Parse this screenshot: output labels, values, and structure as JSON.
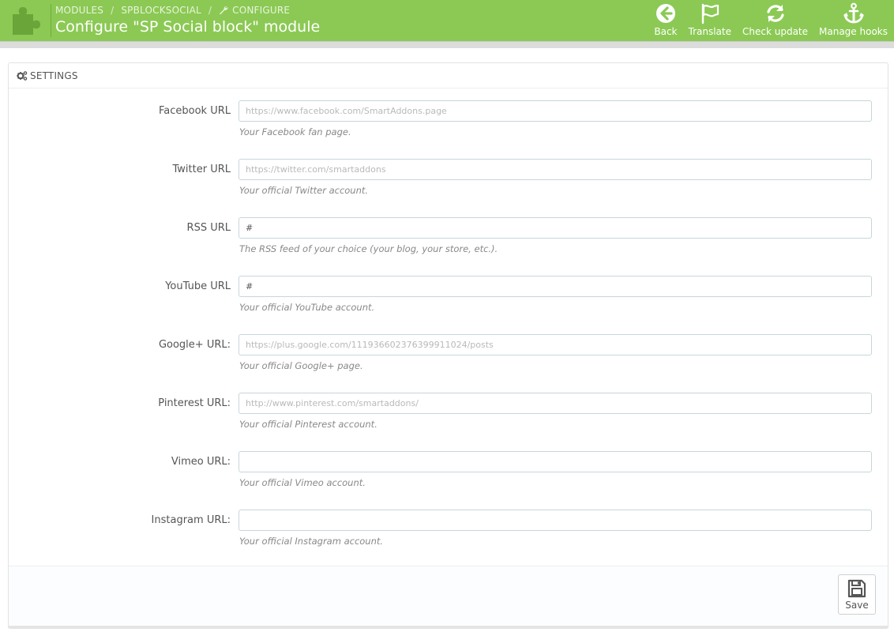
{
  "header": {
    "breadcrumb": [
      "MODULES",
      "SPBLOCKSOCIAL",
      "CONFIGURE"
    ],
    "breadcrumb_separator": "/",
    "title": "Configure \"SP Social block\" module",
    "toolbar": [
      {
        "label": "Back",
        "icon": "back-arrow-icon"
      },
      {
        "label": "Translate",
        "icon": "flag-icon"
      },
      {
        "label": "Check update",
        "icon": "refresh-icon"
      },
      {
        "label": "Manage hooks",
        "icon": "anchor-icon"
      }
    ],
    "colors": {
      "bar": "#8bc954",
      "text": "#ffffff"
    }
  },
  "panel": {
    "heading": "SETTINGS",
    "heading_icon": "cogs-icon",
    "fields": [
      {
        "label": "Facebook URL",
        "value": "https://www.facebook.com/SmartAddons.page",
        "help": "Your Facebook fan page."
      },
      {
        "label": "Twitter URL",
        "value": "https://twitter.com/smartaddons",
        "help": "Your official Twitter account."
      },
      {
        "label": "RSS URL",
        "value": "#",
        "help": "The RSS feed of your choice (your blog, your store, etc.)."
      },
      {
        "label": "YouTube URL",
        "value": "#",
        "help": "Your official YouTube account."
      },
      {
        "label": "Google+ URL:",
        "value": "https://plus.google.com/111936602376399911024/posts",
        "help": "Your official Google+ page."
      },
      {
        "label": "Pinterest URL:",
        "value": "http://www.pinterest.com/smartaddons/",
        "help": "Your official Pinterest account."
      },
      {
        "label": "Vimeo URL:",
        "value": "",
        "help": "Your official Vimeo account."
      },
      {
        "label": "Instagram URL:",
        "value": "",
        "help": "Your official Instagram account."
      }
    ],
    "save_label": "Save"
  }
}
